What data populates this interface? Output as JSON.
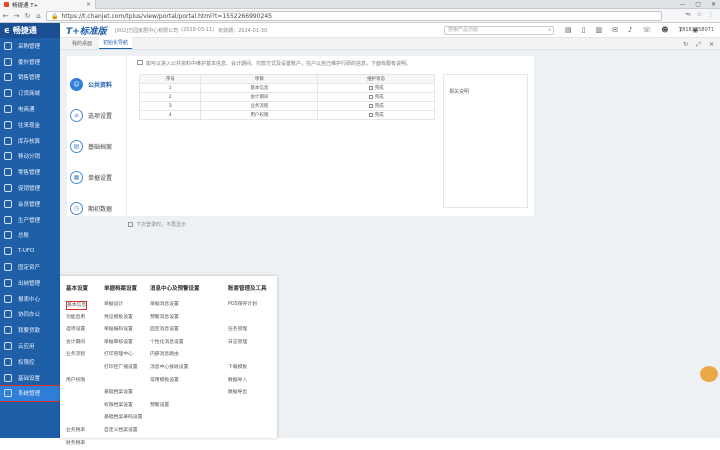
{
  "browser": {
    "tab_title": "畅捷通 T+",
    "url": "https://t.chanjet.com/tplus/view/portal/portal.html?t=1552266990245"
  },
  "sidebar": {
    "logo": "畅捷通",
    "items": [
      {
        "label": "采购管理"
      },
      {
        "label": "委外管理"
      },
      {
        "label": "销售管理"
      },
      {
        "label": "订货商城"
      },
      {
        "label": "电商通"
      },
      {
        "label": "往来现金"
      },
      {
        "label": "库存核算"
      },
      {
        "label": "移动分销"
      },
      {
        "label": "零售管理"
      },
      {
        "label": "促销管理"
      },
      {
        "label": "会员管理"
      },
      {
        "label": "生产管理"
      },
      {
        "label": "总账"
      },
      {
        "label": "T-UFO"
      },
      {
        "label": "固定资产"
      },
      {
        "label": "出纳管理"
      },
      {
        "label": "报表中心"
      },
      {
        "label": "协同办公"
      },
      {
        "label": "我要贷款"
      },
      {
        "label": "云应用"
      },
      {
        "label": "权限控"
      },
      {
        "label": "基础设置"
      },
      {
        "label": "系统管理"
      }
    ],
    "active_index": 22
  },
  "topbar": {
    "brand": "T+标准版",
    "company": "[002]万园家居中心有限公司",
    "period": "(2019-03-11)",
    "expiry": "有效期：2024-01-30",
    "search_placeholder": "搜索产品功能",
    "user": "18181258071"
  },
  "tabs": [
    {
      "label": "我的桌面",
      "active": false
    },
    {
      "label": "初始化导航",
      "active": true
    }
  ],
  "nav": [
    {
      "label": "公共资料",
      "icon": "person",
      "active": true
    },
    {
      "label": "选项设置",
      "icon": "list",
      "active": false
    },
    {
      "label": "基础档案",
      "icon": "doc",
      "active": false
    },
    {
      "label": "单据设置",
      "icon": "doc",
      "active": false
    },
    {
      "label": "期初数据",
      "icon": "clock",
      "active": false
    }
  ],
  "tip": "如可以进入公共资料中维护基本信息、会计期间、付款方式及设置账户，在户以自己维护行即的信息，下面有跟有说明。",
  "table": {
    "headers": [
      "序号",
      "项目",
      "维护状态"
    ],
    "rows": [
      {
        "no": "1",
        "item": "基本信息",
        "status": "完成"
      },
      {
        "no": "2",
        "item": "会计期间",
        "status": "完成"
      },
      {
        "no": "3",
        "item": "业务流程",
        "status": "完成"
      },
      {
        "no": "4",
        "item": "用户权限",
        "status": "完成"
      }
    ]
  },
  "notes_title": "相关说明",
  "footer_tip": "下次登录时，不再显示",
  "popup": {
    "columns": [
      {
        "header": "基本设置",
        "items": [
          "基本信息",
          "功能启用",
          "选项设置",
          "会计期间",
          "业务流程",
          "",
          "用户权限",
          "",
          "",
          "",
          "业务税率",
          "财务税率"
        ]
      },
      {
        "header": "单据档案设置",
        "items": [
          "单据设计",
          "凭证模板设置",
          "单据编码设置",
          "单据审核设置",
          "打印管理中心",
          "打印控广播设置",
          "",
          "基础档案设置",
          "权限档案设置",
          "基础档案录码设置",
          "自定义档案设置"
        ]
      },
      {
        "header": "消息中心及预警设置",
        "items": [
          "单据消息设置",
          "预警消息设置",
          "固定消息设置",
          "个性化消息设置",
          "内部消息路由",
          "消息中心接收设置",
          "常用模板设置",
          "",
          "预警设置"
        ]
      },
      {
        "header": "账套管理及工具",
        "items": [
          "POS保存计划",
          "",
          "任务管理",
          "日志管理",
          "",
          "下载模板",
          "数据导入",
          "数据导出"
        ]
      }
    ],
    "highlighted": "基本信息"
  }
}
